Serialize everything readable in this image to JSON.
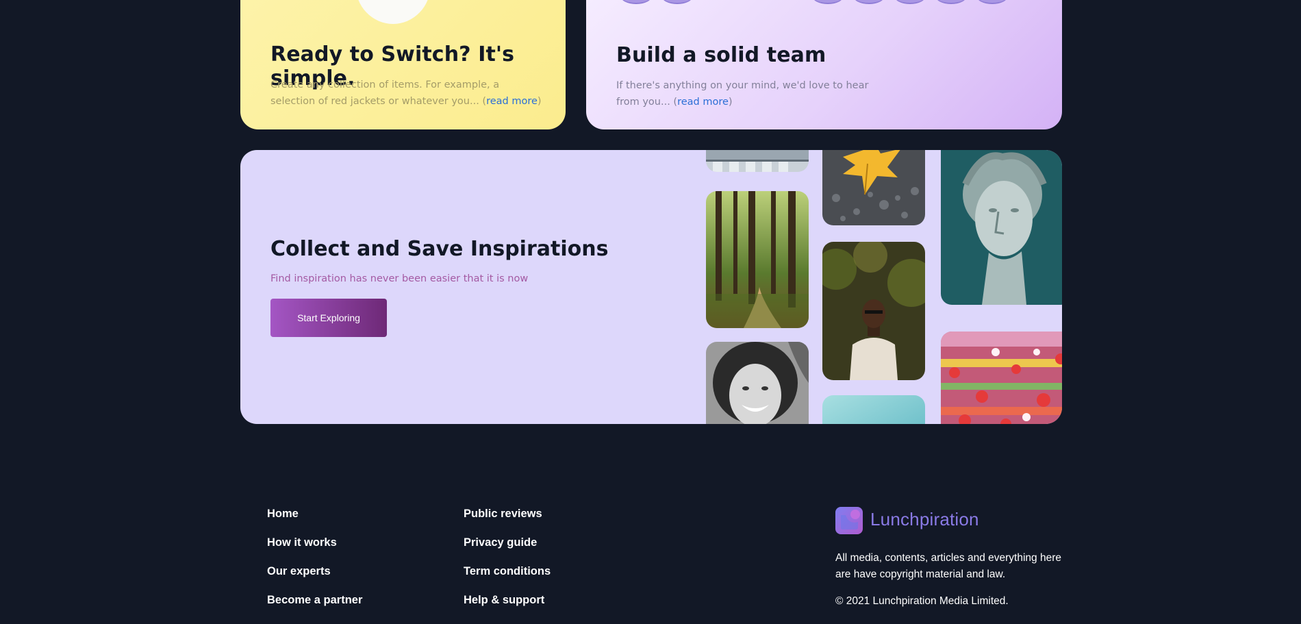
{
  "cards": {
    "switch": {
      "title": "Ready to Switch? It's simple.",
      "text": "Create any collection of items. For example, a selection of red jackets or whatever you... (",
      "link": "read more",
      "close": ")"
    },
    "team": {
      "title": "Build a solid team",
      "text": "If there's anything on your mind, we'd love to hear from you... (",
      "link": "read more",
      "close": ")"
    }
  },
  "inspiration": {
    "title": "Collect and Save Inspirations",
    "subtitle": "Find inspiration has never been easier that it is now",
    "button": "Start Exploring"
  },
  "gallery": [
    "building-photo",
    "forest-path-photo",
    "smiling-woman-photo",
    "yellow-leaf-photo",
    "man-portrait-photo",
    "sky-photo",
    "statue-bust-photo",
    "flowers-photo"
  ],
  "footer": {
    "col1": [
      "Home",
      "How it works",
      "Our experts",
      "Become a partner"
    ],
    "col2": [
      "Public reviews",
      "Privacy guide",
      "Term conditions",
      "Help & support"
    ],
    "brand": "Lunchpiration",
    "copyright_note": "All media, contents, articles and everything here are have copyright material and law.",
    "copyright": "© 2021 Lunchpiration Media Limited."
  },
  "colors": {
    "background": "#121826",
    "yellow_card": "#fdf3a9",
    "purple_card": "#e6d2fb",
    "lavender_panel": "#ddd7fb",
    "link": "#2b6fd6",
    "button_start": "#a456c4",
    "button_end": "#6e2977"
  }
}
